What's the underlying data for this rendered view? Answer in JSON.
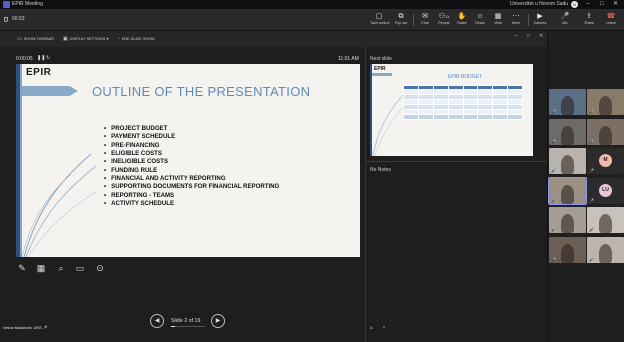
{
  "titlebar": {
    "app_title": "EPIR Meeting",
    "org": "Univerzitet u Novom Sadu",
    "avatar_initials": "N",
    "window_controls": [
      "–",
      "□",
      "✕"
    ]
  },
  "toolbar": {
    "timer": "00:53",
    "buttons": [
      {
        "label": "Take control",
        "icon": "take-control-icon",
        "glyph": "▢"
      },
      {
        "label": "Pop out",
        "icon": "pop-out-icon",
        "glyph": "⧉"
      },
      {
        "label": "Chat",
        "icon": "chat-icon",
        "glyph": "✉"
      },
      {
        "label": "People",
        "icon": "people-icon",
        "glyph": "⚇",
        "count": "11"
      },
      {
        "label": "Raise",
        "icon": "raise-hand-icon",
        "glyph": "✋"
      },
      {
        "label": "React",
        "icon": "react-icon",
        "glyph": "☺"
      },
      {
        "label": "View",
        "icon": "view-icon",
        "glyph": "▦"
      },
      {
        "label": "More",
        "icon": "more-icon",
        "glyph": "⋯"
      },
      {
        "label": "Camera",
        "icon": "camera-icon",
        "glyph": "▶"
      },
      {
        "label": "Mic",
        "icon": "mic-icon",
        "glyph": "🎤"
      },
      {
        "label": "Share",
        "icon": "share-icon",
        "glyph": "⇪"
      },
      {
        "label": "Leave",
        "icon": "leave-icon",
        "glyph": "☎"
      }
    ]
  },
  "presenter_bar": {
    "show_taskbar": "SHOW TASKBAR",
    "display_settings": "DISPLAY SETTINGS ▾",
    "end_slide_show": "END SLIDE SHOW"
  },
  "presenter": {
    "elapsed": "0:00:05",
    "clock": "11:01 AM",
    "slide_counter": "Slide 2 of 19",
    "presenter_name": "Vesna Makalović, UNS",
    "next_slide_label": "Next slide",
    "notes": "No Notes",
    "font_controls": [
      "A",
      "A"
    ]
  },
  "current_slide": {
    "brand": "EPIR",
    "title": "OUTLINE OF THE PRESENTATION",
    "items": [
      "PROJECT BUDGET",
      "PAYMENT SCHEDULE",
      "PRE-FINANCING",
      "ELIGIBLE COSTS",
      "INELIGIBLE COSTS",
      "FUNDING RULE",
      "FINANCIAL AND ACTIVITY REPORTING",
      "SUPPORTING DOCUMENTS FOR FINANCIAL REPORTING",
      "REPORTING - TEAMS",
      "ACTIVITY SCHEDULE"
    ]
  },
  "next_slide": {
    "brand": "EPIR",
    "title": "EPIR BUDGET"
  },
  "gallery": {
    "tiles": [
      {
        "kind": "video",
        "bg": "#5a6f86"
      },
      {
        "kind": "video",
        "bg": "#8a7a68"
      },
      {
        "kind": "video",
        "bg": "#6d6a68"
      },
      {
        "kind": "video",
        "bg": "#7c7066"
      },
      {
        "kind": "video",
        "bg": "#b9b3ad"
      },
      {
        "kind": "initials",
        "initials": "M",
        "bg": "#2b2b2b",
        "accent": "#f0b9a8"
      },
      {
        "kind": "video",
        "bg": "#9a9086"
      },
      {
        "kind": "initials",
        "initials": "LU",
        "bg": "#2b2b2b",
        "accent": "#e8c4d8"
      },
      {
        "kind": "video",
        "bg": "#a69e94"
      },
      {
        "kind": "video",
        "bg": "#c7c2bb"
      },
      {
        "kind": "video",
        "bg": "#6b5e55"
      },
      {
        "kind": "video",
        "bg": "#bdb5ad"
      }
    ]
  },
  "colors": {
    "slide_title": "#5e8bb8",
    "accent": "#5b5fc7",
    "leave": "#e05260"
  }
}
